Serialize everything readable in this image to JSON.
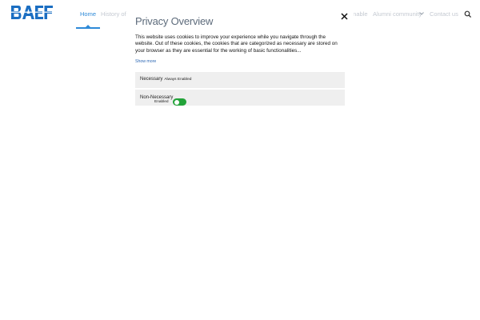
{
  "header": {
    "logo_text": "BAEF",
    "brand_color": "#2e8ad8",
    "nav": {
      "home": "Home",
      "history": "History of th",
      "enable": "enable",
      "community": "Alumni community",
      "contact": "Contact us"
    },
    "icons": {
      "chevron": "chevron-down-icon",
      "search": "search-icon"
    }
  },
  "privacy": {
    "title": "Privacy Overview",
    "body": "This website uses cookies to improve your experience while you navigate through the website. Out of these cookies, the cookies that are categorized as necessary are stored on your browser as they are essential for the working of basic functionalities...",
    "show_more": "Show more",
    "close_icon": "close-icon",
    "necessary": {
      "title": "Necessary",
      "badge": "Always Enabled"
    },
    "non_necessary": {
      "title": "Non-Necessary",
      "state_label": "Enabled",
      "enabled": true,
      "toggle_color": "#22a339"
    }
  }
}
